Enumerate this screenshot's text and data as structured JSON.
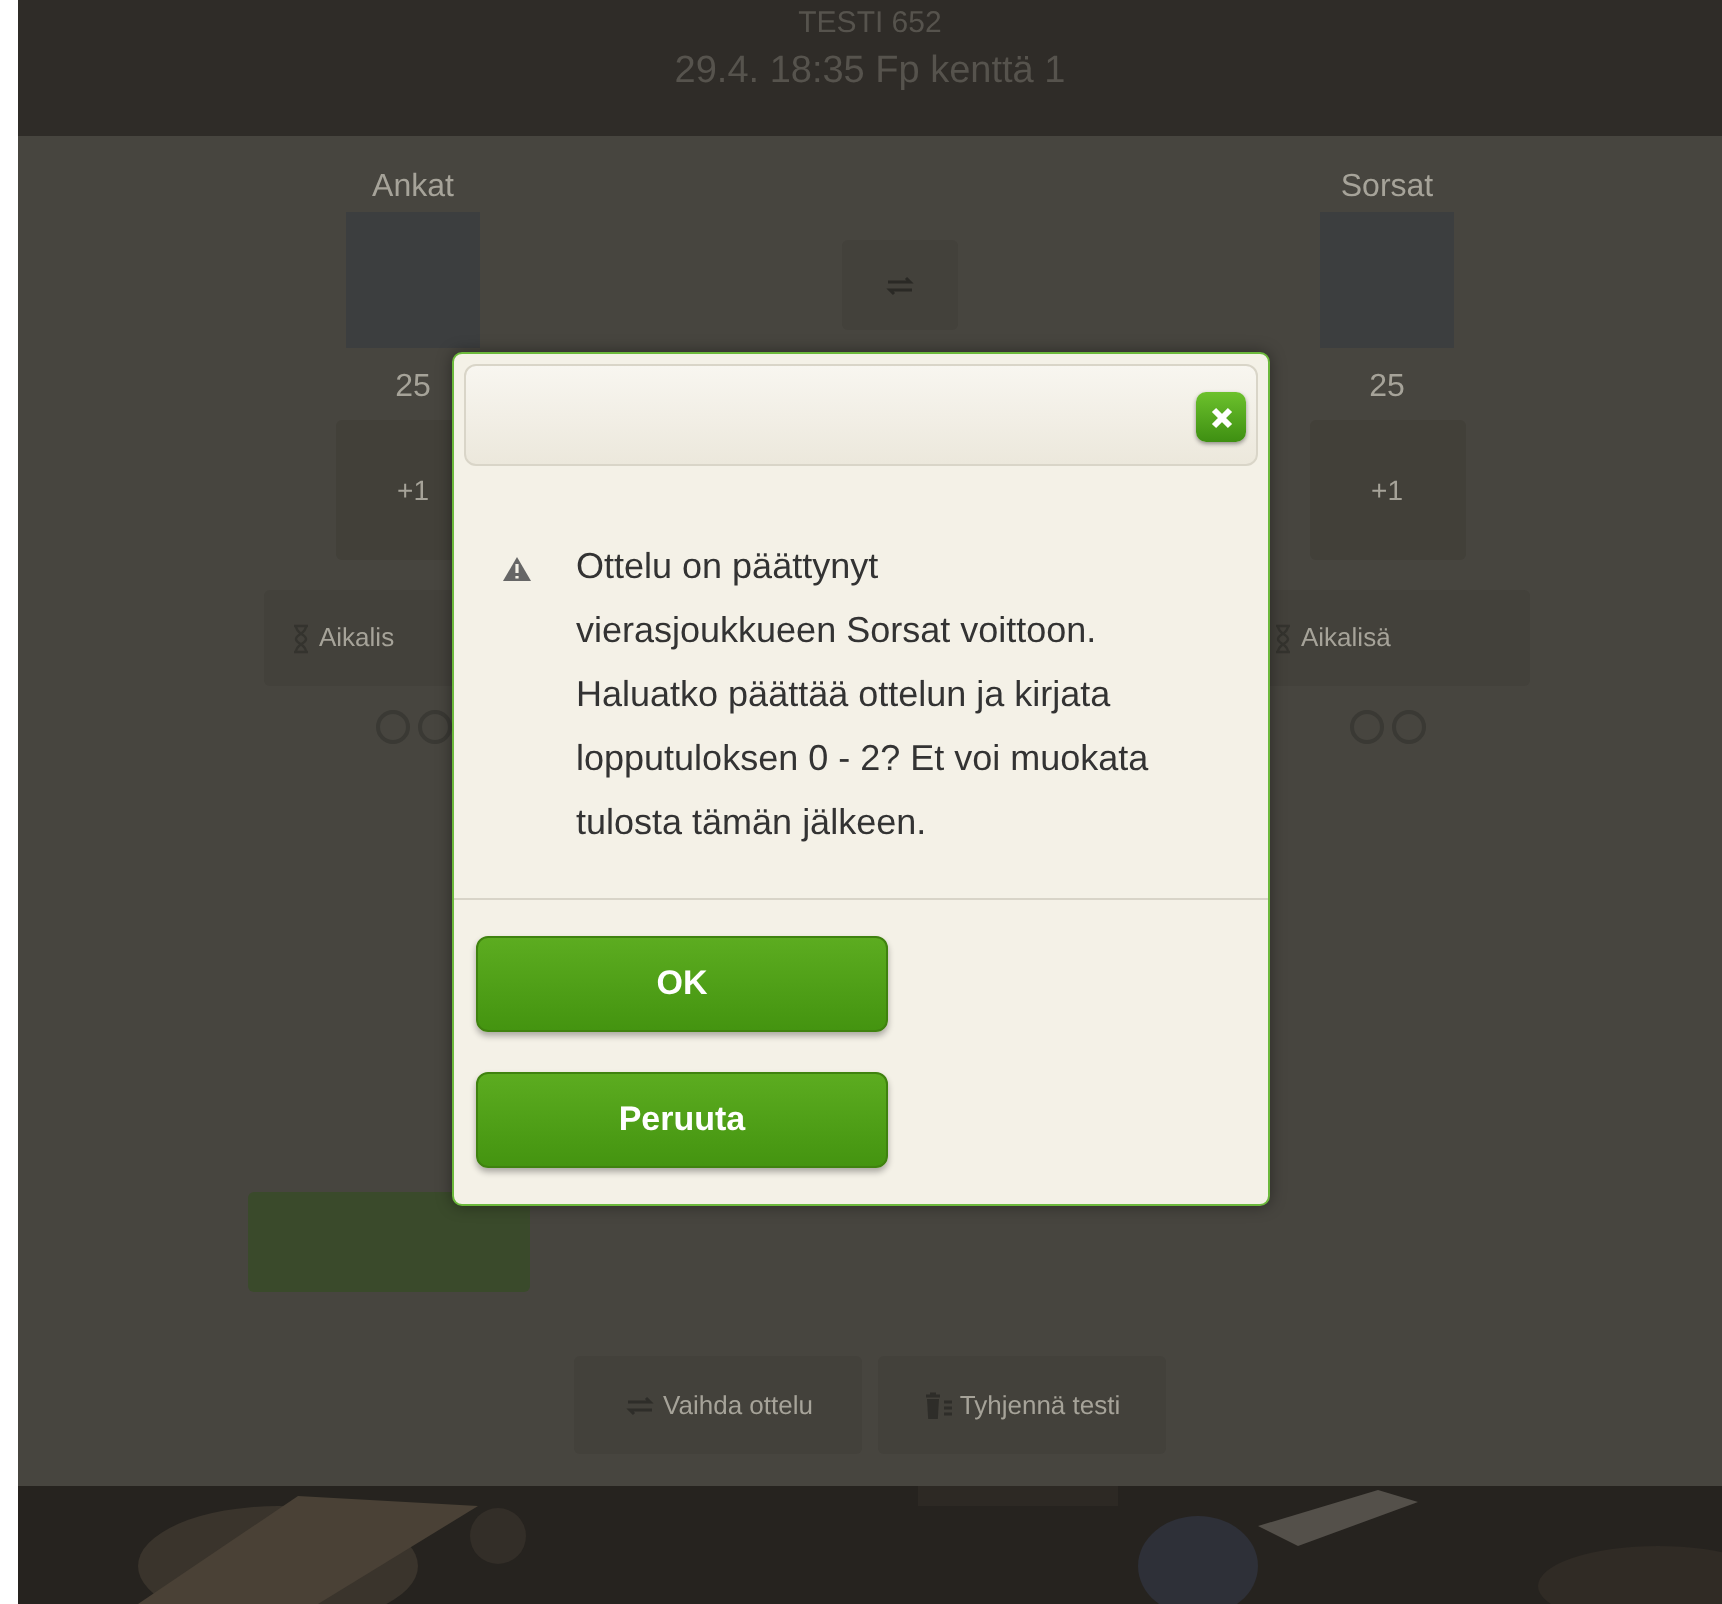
{
  "header": {
    "title": "TESTI 652",
    "subtitle": "29.4. 18:35 Fp kenttä 1"
  },
  "teams": [
    {
      "name": "Ankat",
      "score": "25",
      "add_label": "+1",
      "timeout_label": "Aikalis"
    },
    {
      "name": "Sorsat",
      "score": "25",
      "add_label": "+1",
      "timeout_label": "Aikalisä"
    }
  ],
  "actions": [
    "Vaihda ottelu",
    "Tyhjennä testi"
  ],
  "dialog": {
    "message": "Ottelu on päättynyt\nvierasjoukkueen Sorsat voittoon.\nHaluatko päättää ottelun ja kirjata\nlopputuloksen 0 - 2? Et voi muokata\ntulosta tämän jälkeen.",
    "buttons": [
      "OK",
      "Peruuta"
    ]
  }
}
